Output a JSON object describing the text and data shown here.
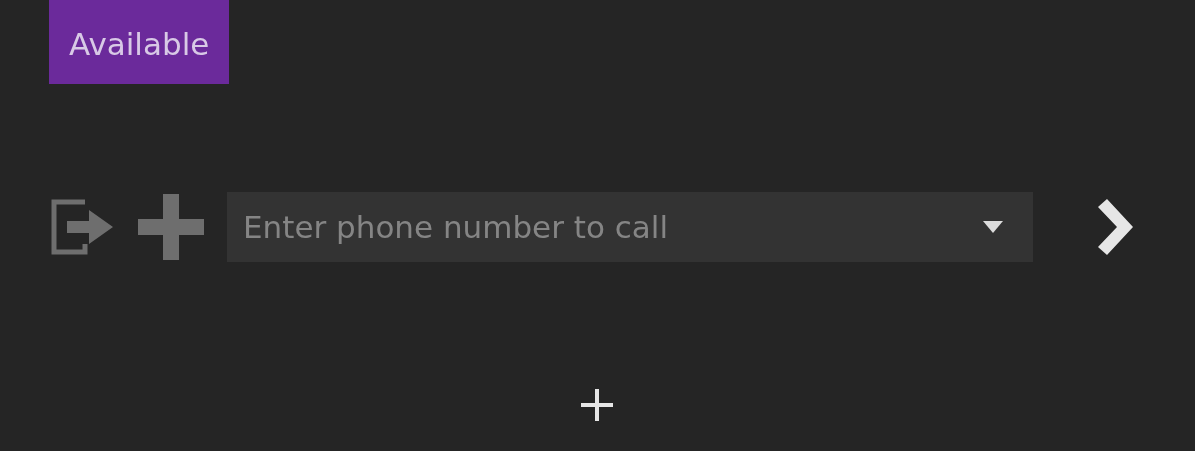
{
  "status": {
    "label": "Available"
  },
  "dial": {
    "placeholder": "Enter phone number to call"
  }
}
